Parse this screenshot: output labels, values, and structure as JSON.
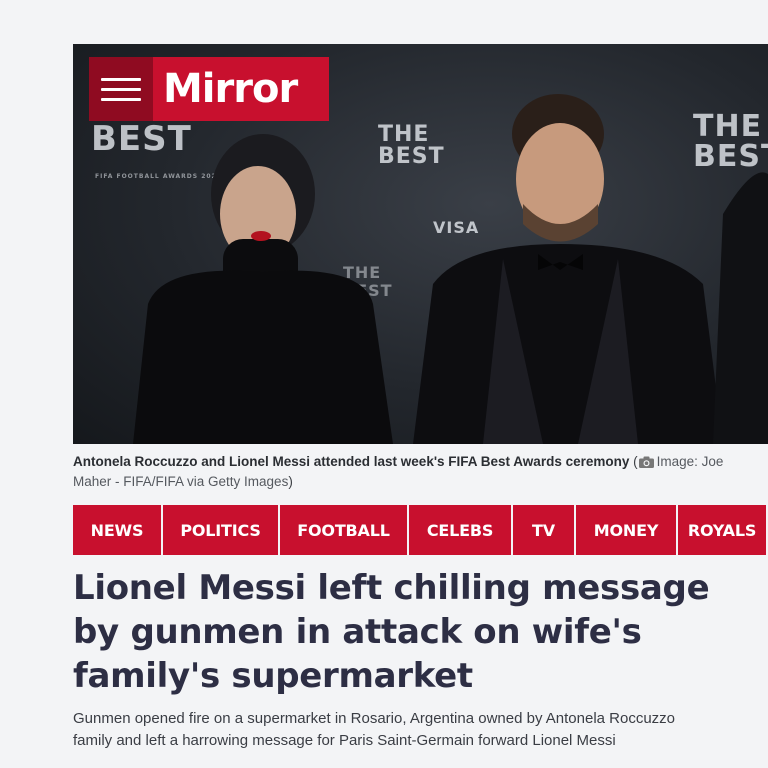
{
  "brand": {
    "logo_text": "Mirror",
    "accent": "#c8102e",
    "accent_dark": "#8f0b21"
  },
  "hero": {
    "backdrop_texts": [
      "BEST",
      "FIFA FOOTBALL AWARDS 2022",
      "THE BEST",
      "THE BEST",
      "VISA",
      "THE BEST"
    ]
  },
  "caption": {
    "text": "Antonela Roccuzzo and Lionel Messi attended last week's FIFA Best Awards ceremony",
    "credit": "Image: Joe Maher - FIFA/FIFA via Getty Images"
  },
  "nav": {
    "items": [
      {
        "label": "NEWS"
      },
      {
        "label": "POLITICS"
      },
      {
        "label": "FOOTBALL"
      },
      {
        "label": "CELEBS"
      },
      {
        "label": "TV"
      },
      {
        "label": "MONEY"
      },
      {
        "label": "ROYALS"
      }
    ]
  },
  "article": {
    "headline": "Lionel Messi left chilling message by gunmen in attack on wife's family's supermarket",
    "standfirst_line1": "Gunmen opened fire on a supermarket in Rosario, Argentina owned by Antonela Roccuzzo",
    "standfirst_line2": "family and left a harrowing message for Paris Saint-Germain forward Lionel Messi"
  }
}
